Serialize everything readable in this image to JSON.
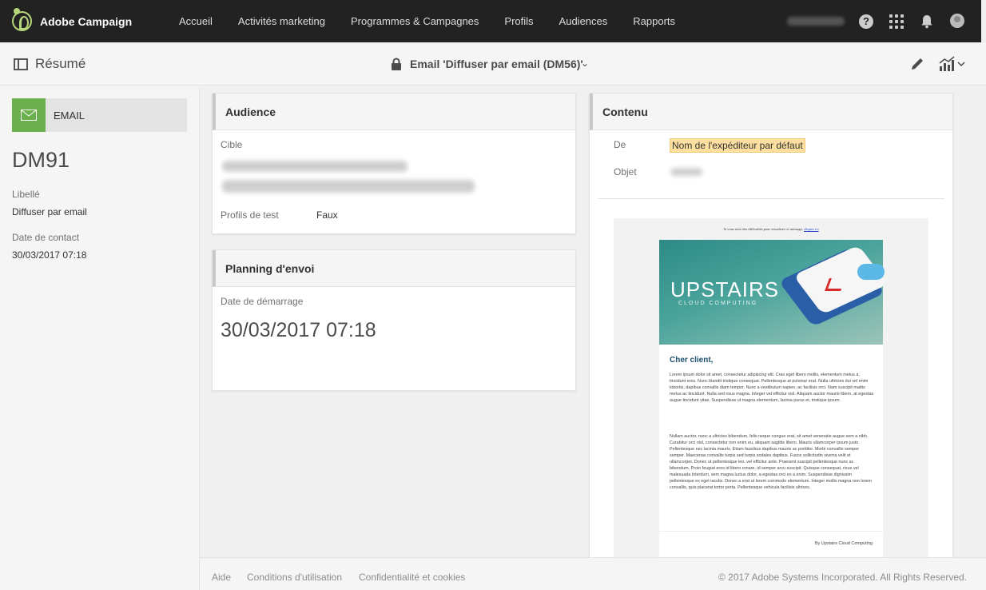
{
  "header": {
    "app_name": "Adobe Campaign",
    "nav": [
      "Accueil",
      "Activités marketing",
      "Programmes & Campagnes",
      "Profils",
      "Audiences",
      "Rapports"
    ],
    "help_glyph": "?"
  },
  "toolbar": {
    "view_label": "Résumé",
    "title": "Email 'Diffuser par email (DM56)'",
    "chevron": "⌄"
  },
  "summary": {
    "channel": "EMAIL",
    "code": "DM91",
    "label_title": "Libellé",
    "label_value": "Diffuser par email",
    "contact_title": "Date de contact",
    "contact_value": "30/03/2017 07:18"
  },
  "audience": {
    "title": "Audience",
    "target_label": "Cible",
    "test_profiles_label": "Profils de test",
    "test_profiles_value": "Faux"
  },
  "planning": {
    "title": "Planning d'envoi",
    "start_label": "Date de démarrage",
    "start_value": "30/03/2017 07:18"
  },
  "content": {
    "title": "Contenu",
    "from_label": "De",
    "from_value": "Nom de l'expéditeur par défaut",
    "subject_label": "Objet",
    "preview": {
      "top_text": "Si vous avez des difficultés pour visualiser ce message,",
      "top_link": "cliquez ici",
      "brand": "UPSTAIRS",
      "brand_sub": "CLOUD COMPUTING",
      "greeting": "Cher client,",
      "para1": "Lorem ipsum dolor sit amet, consectetur adipiscing elit. Cras eget libero mollis, elementum metus a, tincidunt eros. Nunc blandit tristique consequat. Pellentesque at pulvinar erat. Nulla ultricies dui vel enim lobortis, dapibus convallis diam tempor. Nunc a vestibulum sapien, ac facilisis orci. Nam suscipit mattis metus ac tincidunt. Nulla sed risus magna. Integer vel efficitur nisl. Aliquam auctor mauris libero, at egestas augue tincidunt vitae. Suspendisse ut magna elementum, lacinia purus et, tristique ipsum.",
      "para2": "Nullam auctor, nunc a ultricies bibendum, felis neque congue erat, sit amet venenatis augue sem a nibh. Curabitur orci nisl, consectetur non enim eu, aliquam sagittis libero. Mauris ullamcorper ipsum justo. Pellentesque nec lacinia mauris. Etiam faucibus dapibus mauris ac porttitor. Morbi convallis semper semper. Maecenas convallis turpis sed turpis sodales dapibus. Fusce sollicitudin viverra velit et ullamcorper. Donec ut pellentesque leo, vel efficitur ante. Praesent suscipit pellentesque nunc ac bibendum. Proin feugiat eros id libero ornare, id semper arcu suscipit. Quisque consequat, risus vel malesuada interdum, sem magna luctus dolor, a egestas orci ex a enim. Suspendisse dignissim pellentesque ex eget iaculis. Donec a erat ut lorem commodo elementum. Integer mollis magna non lorem convallis, quis placerat tortor porta. Pellentesque vehicula facilisis ultrices.",
      "signature": "By Upstairs Cloud Computing"
    }
  },
  "footer": {
    "links": [
      "Aide",
      "Conditions d'utilisation",
      "Confidentialité et cookies"
    ],
    "copyright": "© 2017 Adobe Systems Incorporated. All Rights Reserved."
  },
  "colors": {
    "topbar": "#222222",
    "email_badge": "#6ab04c",
    "logo_accent": "#b7d77a",
    "sender_highlight": "#fde0a0"
  }
}
